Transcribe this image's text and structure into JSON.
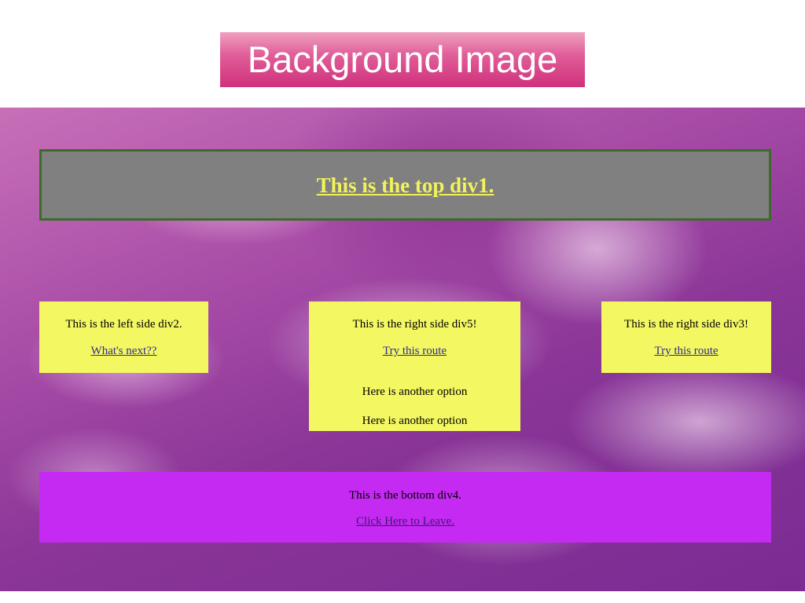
{
  "slide": {
    "title": "Background Image"
  },
  "top_div": {
    "text": "This is the top div1."
  },
  "left_div": {
    "text": "This is the left side div2.",
    "link": "What's next??"
  },
  "middle_div": {
    "text": "This is the right side div5!",
    "link": "Try this route",
    "option_1": "Here is another option",
    "option_2": "Here is another option"
  },
  "right_div": {
    "text": "This is the right side div3!",
    "link": "Try this route"
  },
  "bottom_div": {
    "text": "This is the bottom div4.",
    "link": "Click Here to Leave."
  },
  "colors": {
    "top_div_bg": "#808080",
    "top_div_text": "#f2f25a",
    "side_div_bg": "#f3f762",
    "bottom_div_bg": "#c52af2"
  }
}
